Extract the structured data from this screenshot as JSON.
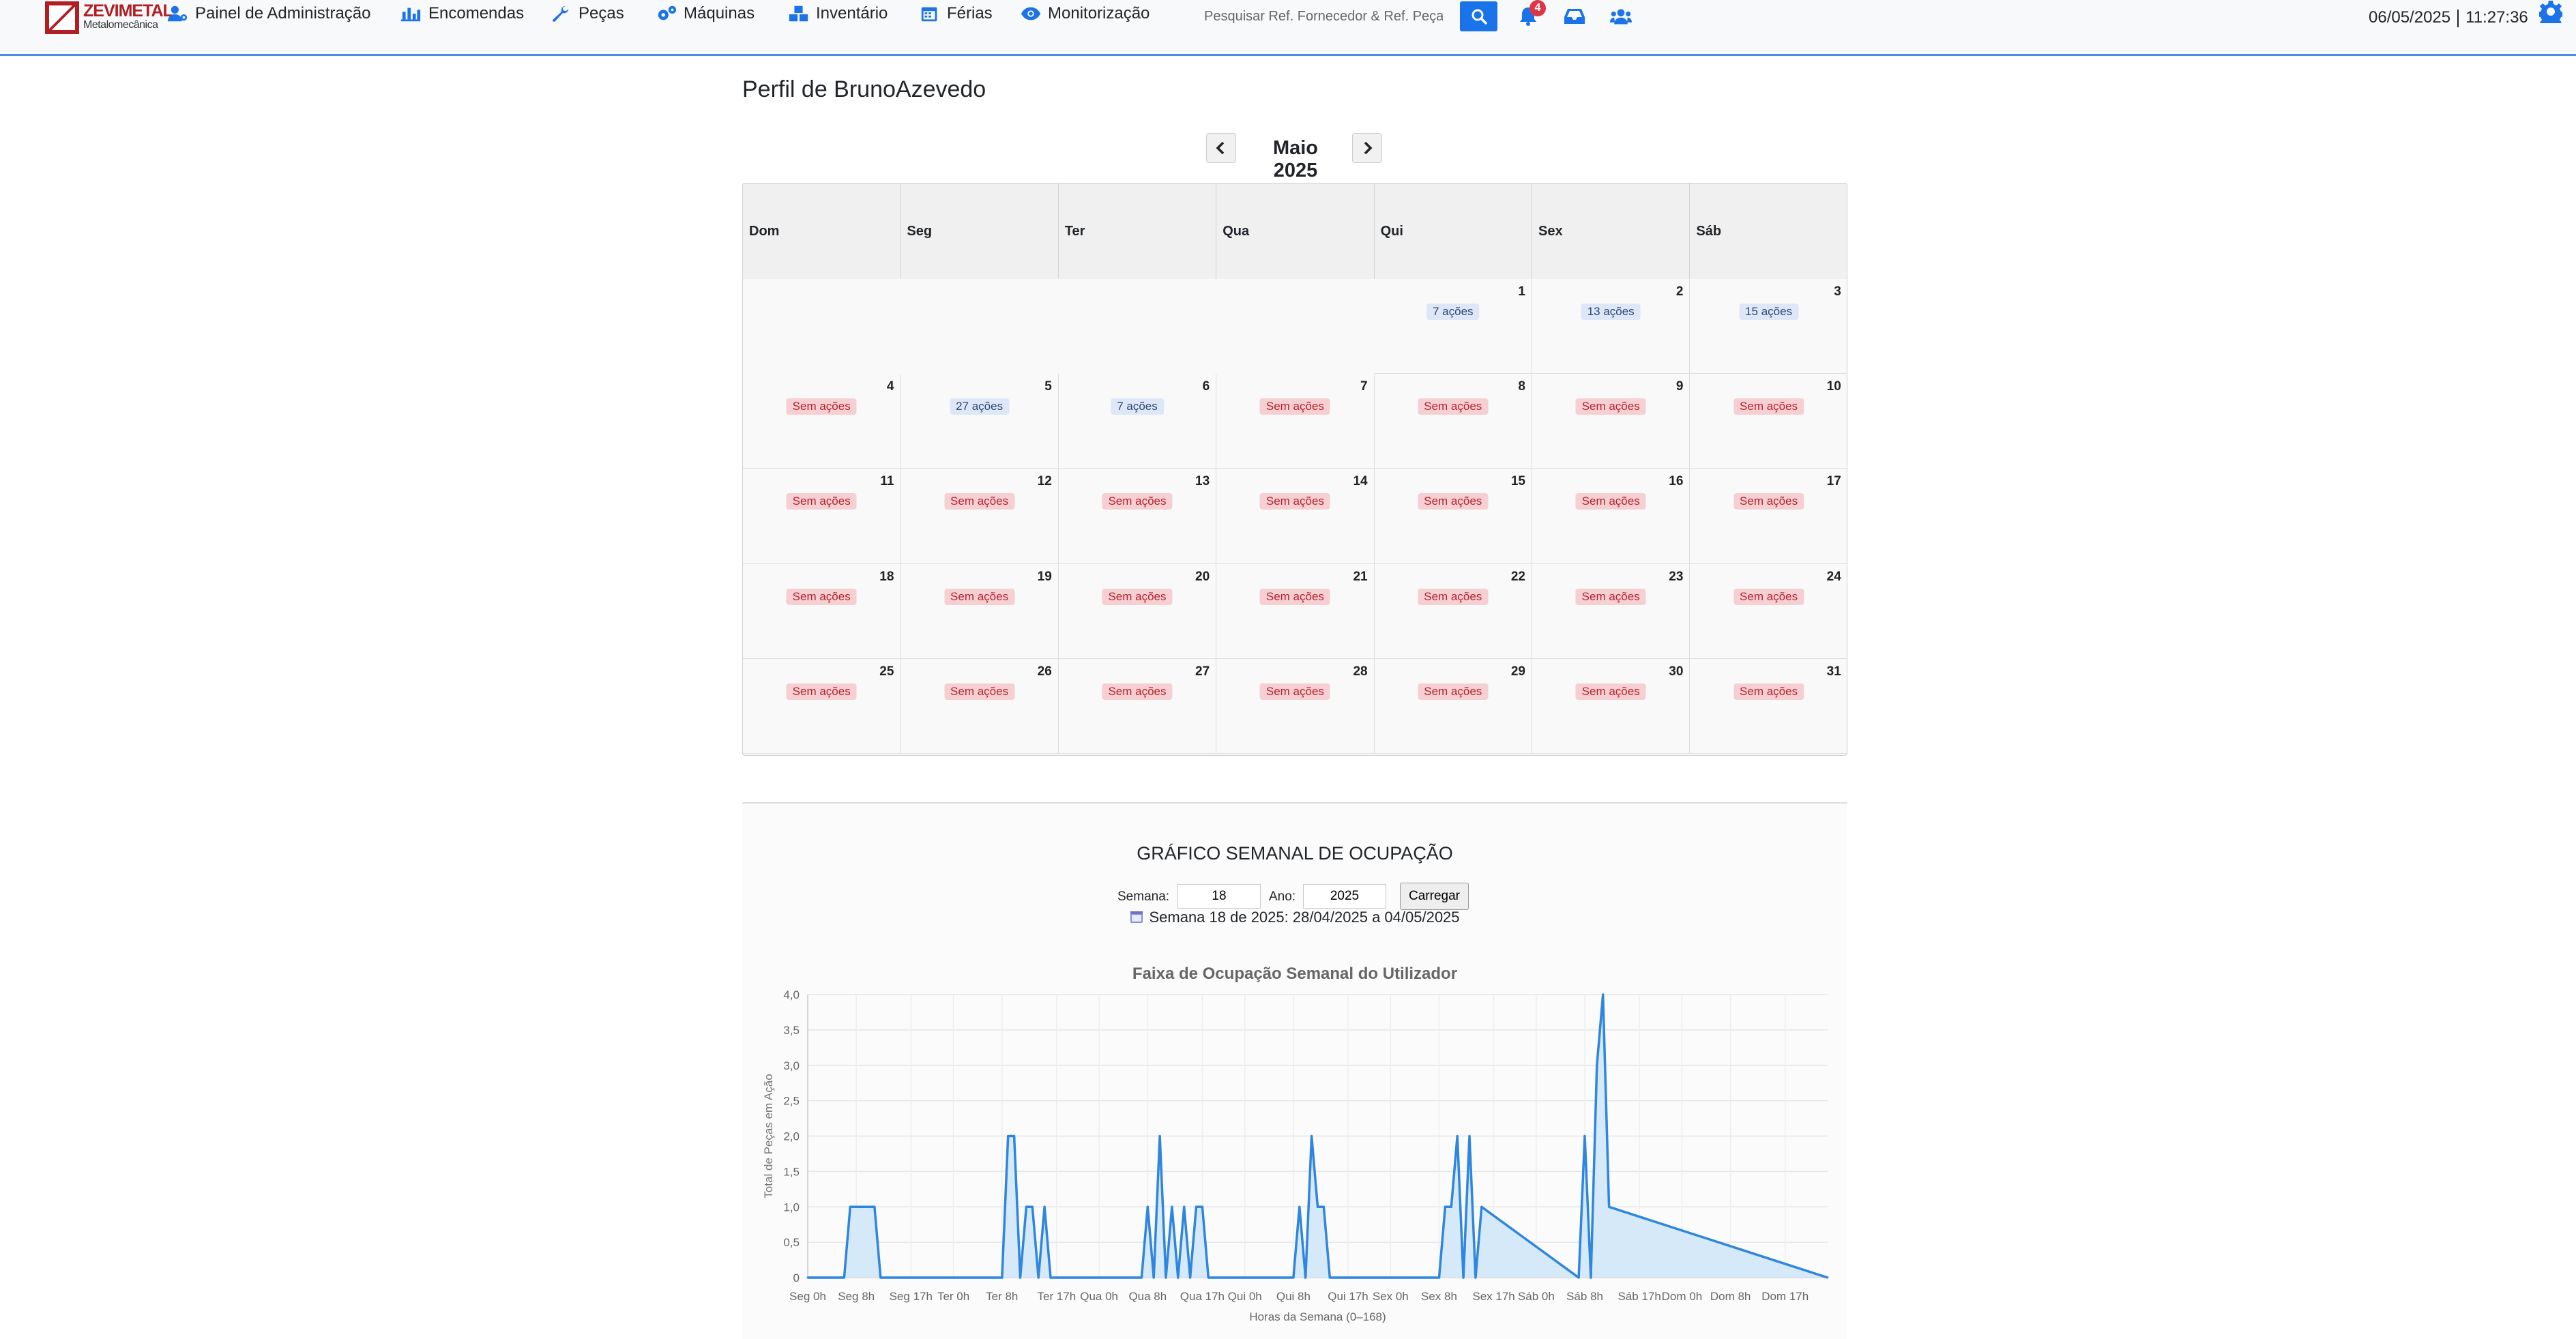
{
  "logo": {
    "brand": "ZEVIMETAL",
    "subtitle": "Metalomecânica"
  },
  "nav": {
    "items": [
      {
        "label": "Painel de Administração",
        "icon": "users-cog-icon"
      },
      {
        "label": "Encomendas",
        "icon": "bar-chart-icon"
      },
      {
        "label": "Peças",
        "icon": "wrench-icon"
      },
      {
        "label": "Máquinas",
        "icon": "cogs-icon"
      },
      {
        "label": "Inventário",
        "icon": "boxes-icon"
      },
      {
        "label": "Férias",
        "icon": "calendar-icon"
      },
      {
        "label": "Monitorização",
        "icon": "eye-icon"
      }
    ],
    "search_placeholder": "Pesquisar Ref. Fornecedor & Ref. Peça",
    "notification_count": "4",
    "date": "06/05/2025",
    "time": "11:27:36",
    "accent_color": "#1a73e8"
  },
  "profile": {
    "title": "Perfil de BrunoAzevedo"
  },
  "calendar": {
    "month_label": "Maio 2025",
    "weekdays": [
      "Dom",
      "Seg",
      "Ter",
      "Qua",
      "Qui",
      "Sex",
      "Sáb"
    ],
    "first_weekday_index": 4,
    "days": [
      {
        "day": "1",
        "status": "7 ações",
        "type": "actions"
      },
      {
        "day": "2",
        "status": "13 ações",
        "type": "actions"
      },
      {
        "day": "3",
        "status": "15 ações",
        "type": "actions"
      },
      {
        "day": "4",
        "status": "Sem ações",
        "type": "none"
      },
      {
        "day": "5",
        "status": "27 ações",
        "type": "actions"
      },
      {
        "day": "6",
        "status": "7 ações",
        "type": "actions"
      },
      {
        "day": "7",
        "status": "Sem ações",
        "type": "none"
      },
      {
        "day": "8",
        "status": "Sem ações",
        "type": "none"
      },
      {
        "day": "9",
        "status": "Sem ações",
        "type": "none"
      },
      {
        "day": "10",
        "status": "Sem ações",
        "type": "none"
      },
      {
        "day": "11",
        "status": "Sem ações",
        "type": "none"
      },
      {
        "day": "12",
        "status": "Sem ações",
        "type": "none"
      },
      {
        "day": "13",
        "status": "Sem ações",
        "type": "none"
      },
      {
        "day": "14",
        "status": "Sem ações",
        "type": "none"
      },
      {
        "day": "15",
        "status": "Sem ações",
        "type": "none"
      },
      {
        "day": "16",
        "status": "Sem ações",
        "type": "none"
      },
      {
        "day": "17",
        "status": "Sem ações",
        "type": "none"
      },
      {
        "day": "18",
        "status": "Sem ações",
        "type": "none"
      },
      {
        "day": "19",
        "status": "Sem ações",
        "type": "none"
      },
      {
        "day": "20",
        "status": "Sem ações",
        "type": "none"
      },
      {
        "day": "21",
        "status": "Sem ações",
        "type": "none"
      },
      {
        "day": "22",
        "status": "Sem ações",
        "type": "none"
      },
      {
        "day": "23",
        "status": "Sem ações",
        "type": "none"
      },
      {
        "day": "24",
        "status": "Sem ações",
        "type": "none"
      },
      {
        "day": "25",
        "status": "Sem ações",
        "type": "none"
      },
      {
        "day": "26",
        "status": "Sem ações",
        "type": "none"
      },
      {
        "day": "27",
        "status": "Sem ações",
        "type": "none"
      },
      {
        "day": "28",
        "status": "Sem ações",
        "type": "none"
      },
      {
        "day": "29",
        "status": "Sem ações",
        "type": "none"
      },
      {
        "day": "30",
        "status": "Sem ações",
        "type": "none"
      },
      {
        "day": "31",
        "status": "Sem ações",
        "type": "none"
      }
    ]
  },
  "weekly": {
    "title": "GRÁFICO SEMANAL DE OCUPAÇÃO",
    "week_label": "Semana:",
    "week_value": "18",
    "year_label": "Ano:",
    "year_value": "2025",
    "load_button": "Carregar",
    "week_info": "Semana 18 de 2025: 28/04/2025 a 04/05/2025"
  },
  "chart_data": {
    "type": "area",
    "title": "Faixa de Ocupação Semanal do Utilizador",
    "xlabel": "Horas da Semana (0–168)",
    "ylabel": "Total de Peças em Ação",
    "xlim": [
      0,
      168
    ],
    "ylim": [
      0,
      4
    ],
    "yticks": [
      "0",
      "0,5",
      "1,0",
      "1,5",
      "2,0",
      "2,5",
      "3,0",
      "3,5",
      "4,0"
    ],
    "xticks": [
      {
        "x": 0,
        "label": "Seg 0h"
      },
      {
        "x": 8,
        "label": "Seg 8h"
      },
      {
        "x": 17,
        "label": "Seg 17h"
      },
      {
        "x": 24,
        "label": "Ter 0h"
      },
      {
        "x": 32,
        "label": "Ter 8h"
      },
      {
        "x": 41,
        "label": "Ter 17h"
      },
      {
        "x": 48,
        "label": "Qua 0h"
      },
      {
        "x": 56,
        "label": "Qua 8h"
      },
      {
        "x": 65,
        "label": "Qua 17h"
      },
      {
        "x": 72,
        "label": "Qui 0h"
      },
      {
        "x": 80,
        "label": "Qui 8h"
      },
      {
        "x": 89,
        "label": "Qui 17h"
      },
      {
        "x": 96,
        "label": "Sex 0h"
      },
      {
        "x": 104,
        "label": "Sex 8h"
      },
      {
        "x": 113,
        "label": "Sex 17h"
      },
      {
        "x": 120,
        "label": "Sáb 0h"
      },
      {
        "x": 128,
        "label": "Sáb 8h"
      },
      {
        "x": 137,
        "label": "Sáb 17h"
      },
      {
        "x": 144,
        "label": "Dom 0h"
      },
      {
        "x": 152,
        "label": "Dom 8h"
      },
      {
        "x": 161,
        "label": "Dom 17h"
      }
    ],
    "grid": true,
    "line_color": "#2e86de",
    "fill_color": "#d6e9f8",
    "series": [
      {
        "x": [
          0,
          6,
          7,
          11,
          12,
          32,
          33,
          34,
          35,
          36,
          37,
          38,
          39,
          40,
          41,
          42,
          55,
          56,
          57,
          58,
          59,
          60,
          61,
          62,
          63,
          64,
          65,
          66,
          67,
          68,
          80,
          81,
          82,
          83,
          84,
          85,
          86,
          104,
          105,
          106,
          107,
          108,
          109,
          110,
          111,
          127,
          128,
          129,
          130,
          131,
          132,
          168
        ],
        "y": [
          0,
          0,
          1,
          1,
          0,
          0,
          2,
          2,
          0,
          1,
          1,
          0,
          1,
          0,
          0,
          0,
          0,
          1,
          0,
          2,
          0,
          1,
          0,
          1,
          0,
          1,
          1,
          0,
          0,
          0,
          0,
          1,
          0,
          2,
          1,
          1,
          0,
          0,
          1,
          1,
          2,
          0,
          2,
          0,
          1,
          0,
          2,
          0,
          3,
          4,
          1,
          0
        ]
      }
    ]
  }
}
